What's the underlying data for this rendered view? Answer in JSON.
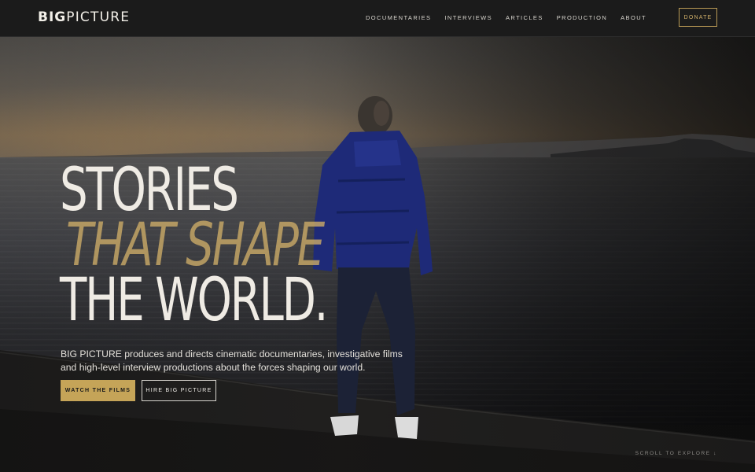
{
  "brand": {
    "logo_bold": "BIG",
    "logo_light": "PICTURE"
  },
  "nav": {
    "items": [
      {
        "label": "DOCUMENTARIES"
      },
      {
        "label": "INTERVIEWS"
      },
      {
        "label": "ARTICLES"
      },
      {
        "label": "PRODUCTION"
      },
      {
        "label": "ABOUT"
      }
    ],
    "donate_label": "DONATE"
  },
  "hero": {
    "eyebrow": "",
    "headline_line1": "STORIES",
    "headline_line2": "THAT SHAPE",
    "headline_line3": "THE WORLD.",
    "lead_line1": "BIG PICTURE produces and directs cinematic documentaries, investigative films",
    "lead_line2": "and high-level interview productions about the forces shaping our world.",
    "primary_cta": "WATCH THE FILMS",
    "secondary_cta": "HIRE BIG PICTURE",
    "scroll_hint": "SCROLL TO EXPLORE ↓"
  },
  "colors": {
    "accent_gold": "#c5a458",
    "nav_background": "#1b1b1b",
    "headline_text": "#efebe4"
  },
  "images": {
    "hero_photo": "person-in-blue-jacket-by-lake-at-dusk"
  }
}
